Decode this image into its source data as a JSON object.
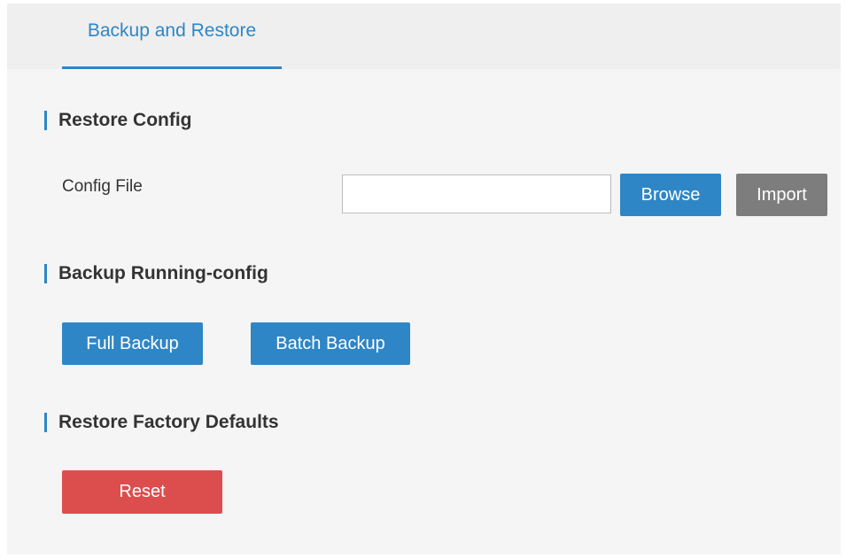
{
  "tabs": [
    {
      "label": "Backup and Restore",
      "active": true
    }
  ],
  "restore_config": {
    "title": "Restore Config",
    "config_file_label": "Config File",
    "config_file_value": "",
    "browse_label": "Browse",
    "import_label": "Import"
  },
  "backup": {
    "title": "Backup Running-config",
    "full_backup_label": "Full Backup",
    "batch_backup_label": "Batch Backup"
  },
  "factory": {
    "title": "Restore Factory Defaults",
    "reset_label": "Reset"
  },
  "colors": {
    "accent": "#2f86c6",
    "button_gray": "#7d7d7d",
    "button_red": "#dc4e4e",
    "background": "#f5f5f5"
  }
}
